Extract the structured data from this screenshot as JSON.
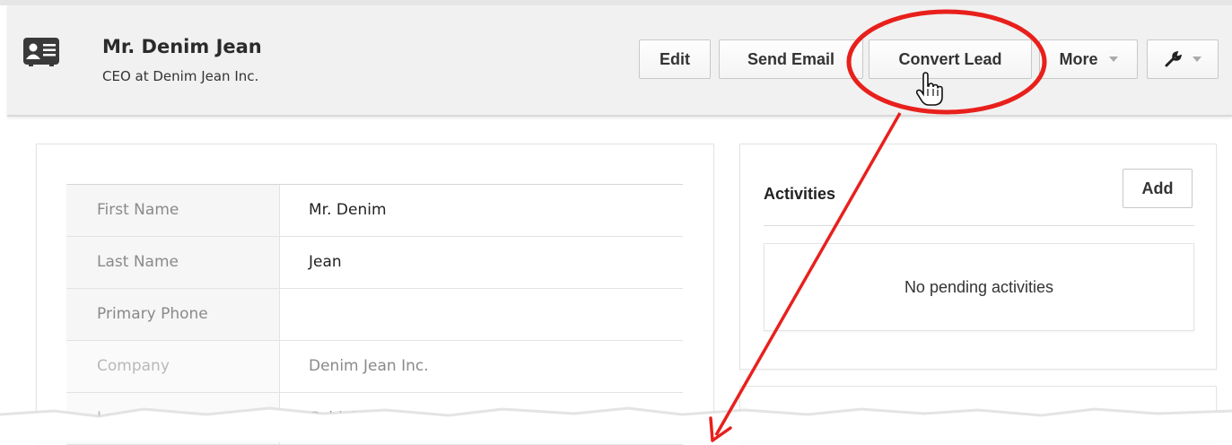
{
  "lead": {
    "name": "Mr. Denim Jean",
    "title": "CEO at Denim Jean Inc.",
    "icon": "contact-card-icon"
  },
  "toolbar": {
    "edit_label": "Edit",
    "send_email_label": "Send Email",
    "convert_lead_label": "Convert Lead",
    "more_label": "More",
    "settings_icon": "wrench-icon"
  },
  "details": {
    "fields": [
      {
        "label": "First Name",
        "value": "Mr. Denim"
      },
      {
        "label": "Last Name",
        "value": "Jean"
      },
      {
        "label": "Primary Phone",
        "value": ""
      },
      {
        "label": "Company",
        "value": "Denim Jean Inc."
      },
      {
        "label": "Lead Source",
        "value": "Cold Call"
      }
    ]
  },
  "activities": {
    "title": "Activities",
    "add_label": "Add",
    "empty_text": "No pending activities"
  },
  "colors": {
    "annotation": "#e8201c",
    "header_bg": "#f1f1f1"
  }
}
